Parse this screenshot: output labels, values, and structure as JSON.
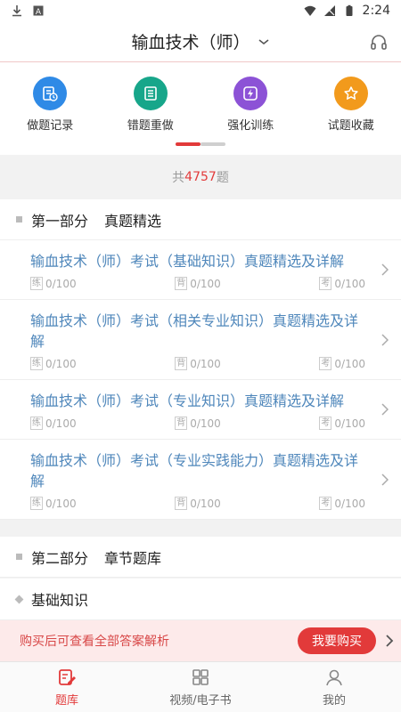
{
  "status_bar": {
    "time": "2:24"
  },
  "header": {
    "title": "输血技术（师）"
  },
  "quick_actions": [
    {
      "label": "做题记录",
      "icon": "history-icon",
      "color": "#2f8ae6"
    },
    {
      "label": "错题重做",
      "icon": "wrong-list-icon",
      "color": "#17a68a"
    },
    {
      "label": "强化训练",
      "icon": "lightning-icon",
      "color": "#8c52d6"
    },
    {
      "label": "试题收藏",
      "icon": "star-icon",
      "color": "#f29a1c"
    }
  ],
  "total": {
    "prefix": "共",
    "count": "4757",
    "suffix": "题"
  },
  "section1": {
    "part": "第一部分",
    "name": "真题精选"
  },
  "exams": [
    {
      "title": "输血技术（师）考试（基础知识）真题精选及详解",
      "practice_tag": "练",
      "practice": "0/100",
      "memorize_tag": "背",
      "memorize": "0/100",
      "exam_tag": "考",
      "exam": "0/100"
    },
    {
      "title": "输血技术（师）考试（相关专业知识）真题精选及详解",
      "practice_tag": "练",
      "practice": "0/100",
      "memorize_tag": "背",
      "memorize": "0/100",
      "exam_tag": "考",
      "exam": "0/100"
    },
    {
      "title": "输血技术（师）考试（专业知识）真题精选及详解",
      "practice_tag": "练",
      "practice": "0/100",
      "memorize_tag": "背",
      "memorize": "0/100",
      "exam_tag": "考",
      "exam": "0/100"
    },
    {
      "title": "输血技术（师）考试（专业实践能力）真题精选及详解",
      "practice_tag": "练",
      "practice": "0/100",
      "memorize_tag": "背",
      "memorize": "0/100",
      "exam_tag": "考",
      "exam": "0/100"
    }
  ],
  "section2": {
    "part": "第二部分",
    "name": "章节题库"
  },
  "subsection": {
    "name": "基础知识"
  },
  "buy_bar": {
    "text": "购买后可查看全部答案解析",
    "button": "我要购买"
  },
  "tabs": [
    {
      "label": "题库",
      "active": true
    },
    {
      "label": "视频/电子书",
      "active": false
    },
    {
      "label": "我的",
      "active": false
    }
  ],
  "colors": {
    "accent": "#e23a3a",
    "link": "#4f87bb"
  }
}
